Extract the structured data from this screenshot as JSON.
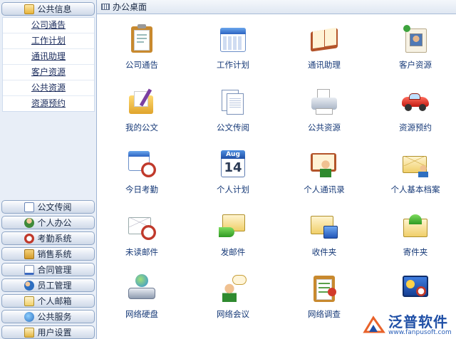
{
  "sidebar": {
    "active_section": "公共信息",
    "sub_items": [
      "公司通告",
      "工作计划",
      "通讯助理",
      "客户资源",
      "公共资源",
      "资源预约"
    ],
    "sections": [
      "公文传阅",
      "个人办公",
      "考勤系统",
      "销售系统",
      "合同管理",
      "员工管理",
      "个人邮箱",
      "公共服务",
      "用户设置"
    ]
  },
  "main": {
    "title": "办公桌面",
    "tiles": [
      {
        "label": "公司通告",
        "icon": "notice-clipboard-icon"
      },
      {
        "label": "工作计划",
        "icon": "calendar-icon"
      },
      {
        "label": "通讯助理",
        "icon": "address-book-icon"
      },
      {
        "label": "客户资源",
        "icon": "contact-card-icon"
      },
      {
        "label": "我的公文",
        "icon": "folder-pen-icon"
      },
      {
        "label": "公文传阅",
        "icon": "documents-icon"
      },
      {
        "label": "公共资源",
        "icon": "printer-icon"
      },
      {
        "label": "资源预约",
        "icon": "car-icon"
      },
      {
        "label": "今日考勤",
        "icon": "calendar-clock-icon"
      },
      {
        "label": "个人计划",
        "icon": "date-calendar-icon"
      },
      {
        "label": "个人通讯录",
        "icon": "person-book-icon"
      },
      {
        "label": "个人基本档案",
        "icon": "profile-envelope-icon"
      },
      {
        "label": "未读邮件",
        "icon": "mail-clock-icon"
      },
      {
        "label": "发邮件",
        "icon": "send-mail-icon"
      },
      {
        "label": "收件夹",
        "icon": "inbox-icon"
      },
      {
        "label": "寄件夹",
        "icon": "outbox-icon"
      },
      {
        "label": "网络硬盘",
        "icon": "network-drive-icon"
      },
      {
        "label": "网络会议",
        "icon": "meeting-icon"
      },
      {
        "label": "网络调查",
        "icon": "survey-icon"
      },
      {
        "label": "",
        "icon": "desktop-settings-icon"
      }
    ],
    "calendar_date_text": {
      "month": "Aug",
      "day": "14"
    }
  },
  "watermark": {
    "name": "泛普软件",
    "url": "www.fanpusoft.com"
  }
}
